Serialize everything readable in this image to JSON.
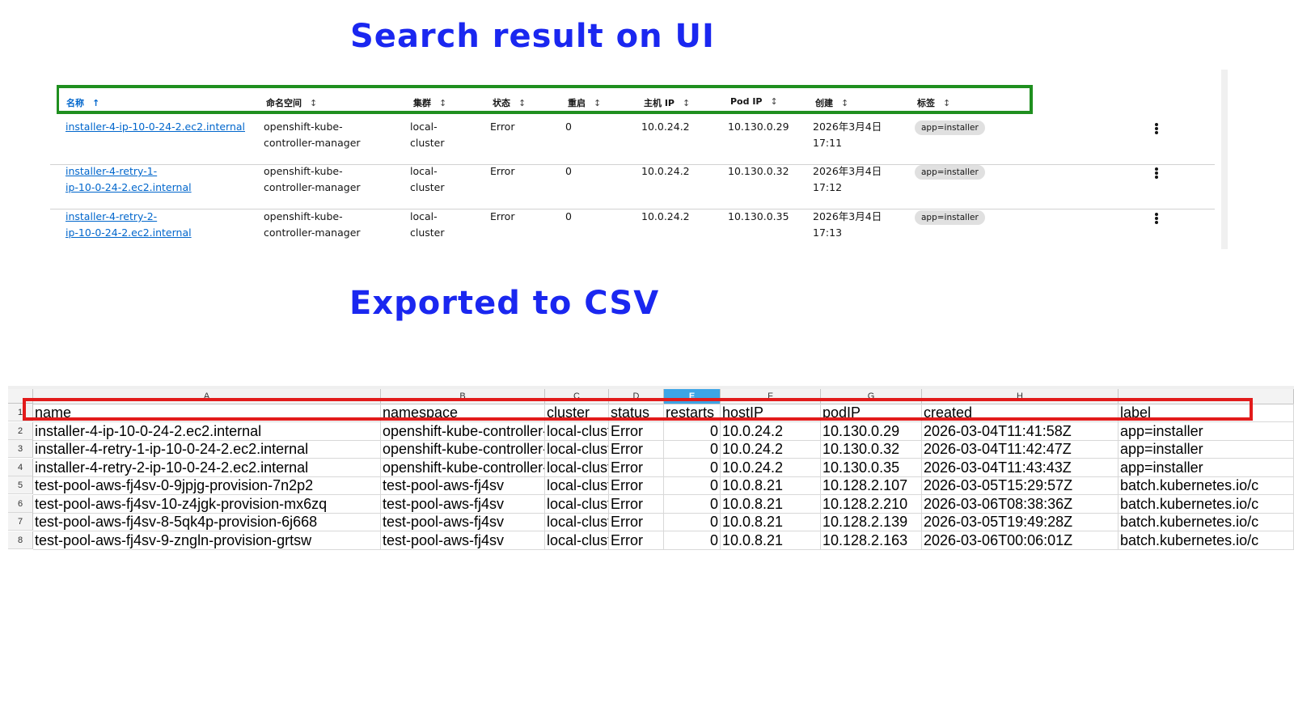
{
  "titles": {
    "ui": "Search result on UI",
    "csv": "Exported to CSV"
  },
  "ui_table": {
    "columns": [
      {
        "label": "名称",
        "sorted": true
      },
      {
        "label": "命名空间",
        "sorted": false
      },
      {
        "label": "集群",
        "sorted": false
      },
      {
        "label": "状态",
        "sorted": false
      },
      {
        "label": "重启",
        "sorted": false
      },
      {
        "label": "主机 IP",
        "sorted": false
      },
      {
        "label": "Pod IP",
        "sorted": false
      },
      {
        "label": "创建",
        "sorted": false
      },
      {
        "label": "标签",
        "sorted": false
      }
    ],
    "sort_icon_active": "↑",
    "sort_icon_inactive": "↕",
    "rows": [
      {
        "name": [
          "installer-4-ip-10-0-24-2.ec2.internal"
        ],
        "namespace": [
          "openshift-kube-",
          "controller-manager"
        ],
        "cluster": [
          "local-",
          "cluster"
        ],
        "status": "Error",
        "restarts": "0",
        "host_ip": "10.0.24.2",
        "pod_ip": "10.130.0.29",
        "created": [
          "2026年3月4日",
          "17:11"
        ],
        "label": "app=installer"
      },
      {
        "name": [
          "installer-4-retry-1-",
          "ip-10-0-24-2.ec2.internal"
        ],
        "namespace": [
          "openshift-kube-",
          "controller-manager"
        ],
        "cluster": [
          "local-",
          "cluster"
        ],
        "status": "Error",
        "restarts": "0",
        "host_ip": "10.0.24.2",
        "pod_ip": "10.130.0.32",
        "created": [
          "2026年3月4日",
          "17:12"
        ],
        "label": "app=installer"
      },
      {
        "name": [
          "installer-4-retry-2-",
          "ip-10-0-24-2.ec2.internal"
        ],
        "namespace": [
          "openshift-kube-",
          "controller-manager"
        ],
        "cluster": [
          "local-",
          "cluster"
        ],
        "status": "Error",
        "restarts": "0",
        "host_ip": "10.0.24.2",
        "pod_ip": "10.130.0.35",
        "created": [
          "2026年3月4日",
          "17:13"
        ],
        "label": "app=installer"
      }
    ],
    "row_action_icon": "kebab-icon"
  },
  "spreadsheet": {
    "column_letters": [
      "A",
      "B",
      "C",
      "D",
      "E",
      "F",
      "G",
      "H",
      ""
    ],
    "selected_column": "E",
    "row_numbers": [
      "1",
      "2",
      "3",
      "4",
      "5",
      "6",
      "7",
      "8"
    ],
    "rows": [
      [
        "name",
        "namespace",
        "cluster",
        "status",
        "restarts",
        "hostIP",
        "podIP",
        "created",
        "label"
      ],
      [
        "installer-4-ip-10-0-24-2.ec2.internal",
        "openshift-kube-controller-manager",
        "local-cluster",
        "Error",
        "0",
        "10.0.24.2",
        "10.130.0.29",
        "2026-03-04T11:41:58Z",
        "app=installer"
      ],
      [
        "installer-4-retry-1-ip-10-0-24-2.ec2.internal",
        "openshift-kube-controller-manager",
        "local-cluster",
        "Error",
        "0",
        "10.0.24.2",
        "10.130.0.32",
        "2026-03-04T11:42:47Z",
        "app=installer"
      ],
      [
        "installer-4-retry-2-ip-10-0-24-2.ec2.internal",
        "openshift-kube-controller-manager",
        "local-cluster",
        "Error",
        "0",
        "10.0.24.2",
        "10.130.0.35",
        "2026-03-04T11:43:43Z",
        "app=installer"
      ],
      [
        "test-pool-aws-fj4sv-0-9jpjg-provision-7n2p2",
        "test-pool-aws-fj4sv",
        "local-cluster",
        "Error",
        "0",
        "10.0.8.21",
        "10.128.2.107",
        "2026-03-05T15:29:57Z",
        "batch.kubernetes.io/c"
      ],
      [
        "test-pool-aws-fj4sv-10-z4jgk-provision-mx6zq",
        "test-pool-aws-fj4sv",
        "local-cluster",
        "Error",
        "0",
        "10.0.8.21",
        "10.128.2.210",
        "2026-03-06T08:38:36Z",
        "batch.kubernetes.io/c"
      ],
      [
        "test-pool-aws-fj4sv-8-5qk4p-provision-6j668",
        "test-pool-aws-fj4sv",
        "local-cluster",
        "Error",
        "0",
        "10.0.8.21",
        "10.128.2.139",
        "2026-03-05T19:49:28Z",
        "batch.kubernetes.io/c"
      ],
      [
        "test-pool-aws-fj4sv-9-zngln-provision-grtsw",
        "test-pool-aws-fj4sv",
        "local-cluster",
        "Error",
        "0",
        "10.0.8.21",
        "10.128.2.163",
        "2026-03-06T00:06:01Z",
        "batch.kubernetes.io/c"
      ]
    ]
  },
  "colors": {
    "title": "#1a27f0",
    "ui_header_highlight": "#1f8f1f",
    "csv_header_highlight": "#e21b1b",
    "link": "#0066cc",
    "selected_column": "#3da5e6"
  }
}
